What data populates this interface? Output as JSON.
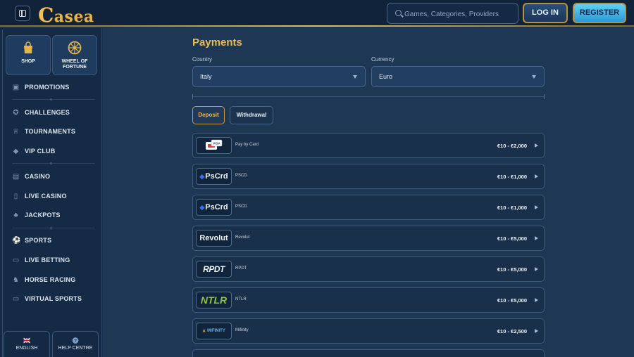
{
  "header": {
    "logo_text": "Casea",
    "search_placeholder": "Games, Categories, Providers",
    "login_label": "LOG IN",
    "register_label": "REGISTER"
  },
  "sidebar": {
    "tiles": [
      {
        "label": "SHOP",
        "icon": "shopping-bag-icon"
      },
      {
        "label": "WHEEL OF FORTUNE",
        "icon": "wheel-icon"
      }
    ],
    "items": [
      {
        "label": "PROMOTIONS",
        "icon": "gift-icon"
      },
      {
        "label": "CHALLENGES",
        "icon": "medal-icon"
      },
      {
        "label": "TOURNAMENTS",
        "icon": "trophy-icon"
      },
      {
        "label": "VIP CLUB",
        "icon": "diamond-icon"
      },
      {
        "label": "CASINO",
        "icon": "slot-icon"
      },
      {
        "label": "LIVE CASINO",
        "icon": "phone-icon"
      },
      {
        "label": "JACKPOTS",
        "icon": "clover-icon"
      },
      {
        "label": "SPORTS",
        "icon": "ball-icon"
      },
      {
        "label": "LIVE BETTING",
        "icon": "screen-icon"
      },
      {
        "label": "HORSE RACING",
        "icon": "horse-icon"
      },
      {
        "label": "VIRTUAL SPORTS",
        "icon": "monitor-icon"
      }
    ],
    "footer": {
      "language_label": "ENGLISH",
      "help_label": "HELP CENTRE"
    }
  },
  "main": {
    "title": "Payments",
    "country_label": "Country",
    "country_value": "Italy",
    "currency_label": "Currency",
    "currency_value": "Euro",
    "tabs": [
      "Deposit",
      "Withdrawal"
    ],
    "methods": [
      {
        "logo": "VISA",
        "name": "Pay by Card",
        "limits": "€10 - €2,000"
      },
      {
        "logo": "PsCrd",
        "name": "PSCD",
        "limits": "€10 - €1,000"
      },
      {
        "logo": "PsCrd",
        "name": "PSCD",
        "limits": "€10 - €1,000"
      },
      {
        "logo": "Revolut",
        "name": "Revolut",
        "limits": "€10 - €5,000"
      },
      {
        "logo": "RPDT",
        "name": "RPDT",
        "limits": "€10 - €5,000"
      },
      {
        "logo": "NTLR",
        "name": "NTLR",
        "limits": "€10 - €5,000"
      },
      {
        "logo": "MIFINITY",
        "name": "Mifinity",
        "limits": "€10 - €2,500"
      }
    ]
  },
  "colors": {
    "accent_gold": "#e7bb58",
    "register_blue": "#2c97d6",
    "background": "#1e3754"
  }
}
